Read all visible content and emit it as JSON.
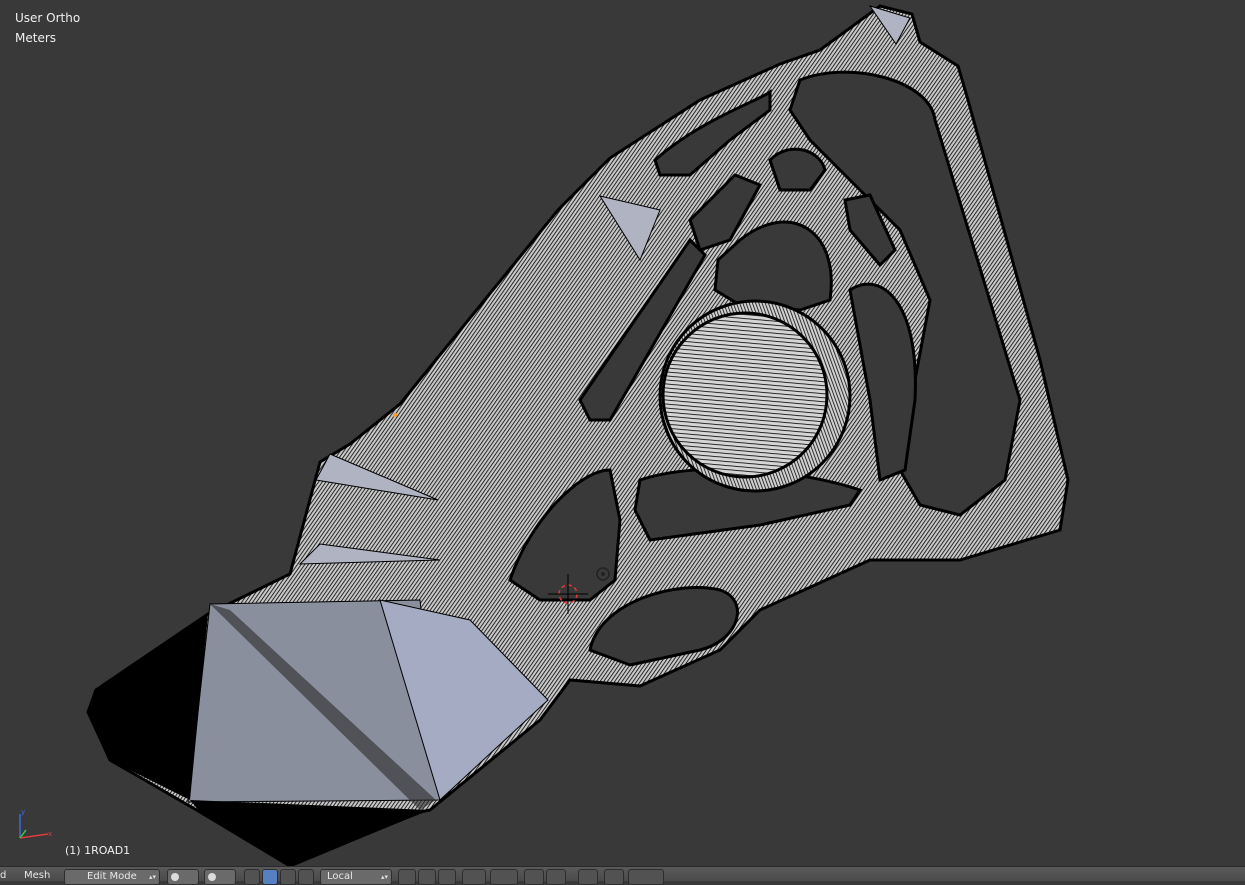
{
  "viewport": {
    "view_type": "User Ortho",
    "units": "Meters",
    "object_info": "(1) 1ROAD1"
  },
  "header": {
    "view_menu_partial": "d",
    "mesh_menu": "Mesh",
    "mode_select": "Edit Mode",
    "pivot_select": "Local"
  },
  "colors": {
    "background": "#393939",
    "mesh_face": "#8a8f9e",
    "mesh_face_selected": "#a4abc2",
    "wire": "#000000",
    "axis_x": "#e03a3a",
    "axis_y": "#40c040",
    "axis_z": "#3a6ae0",
    "header_active": "#5680c2"
  }
}
